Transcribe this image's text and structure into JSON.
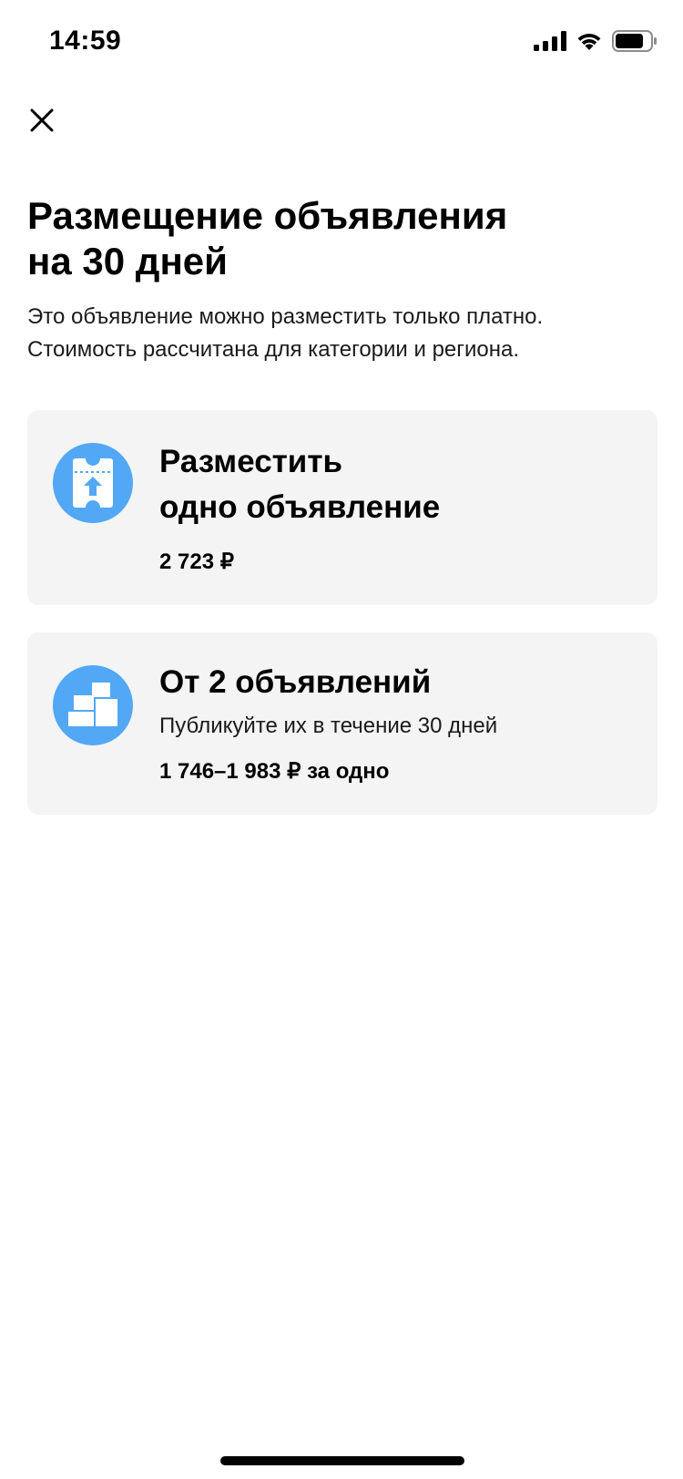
{
  "status_bar": {
    "time": "14:59"
  },
  "header": {
    "close_icon": "close-icon"
  },
  "content": {
    "title_line1": "Размещение объявления",
    "title_line2": "на 30 дней",
    "subtitle_line1": "Это объявление можно разместить только платно.",
    "subtitle_line2": "Стоимость рассчитана для категории и региона."
  },
  "options": [
    {
      "icon": "ticket-upload-icon",
      "title_line1": "Разместить",
      "title_line2": "одно объявление",
      "price": "2 723 ₽"
    },
    {
      "icon": "boxes-icon",
      "title": "От 2 объявлений",
      "description": "Публикуйте их в течение 30 дней",
      "price": "1 746–1 983 ₽ за одно"
    }
  ],
  "colors": {
    "accent": "#52a8f5",
    "card_background": "#f4f4f4",
    "background": "#ffffff",
    "text": "#000000"
  }
}
